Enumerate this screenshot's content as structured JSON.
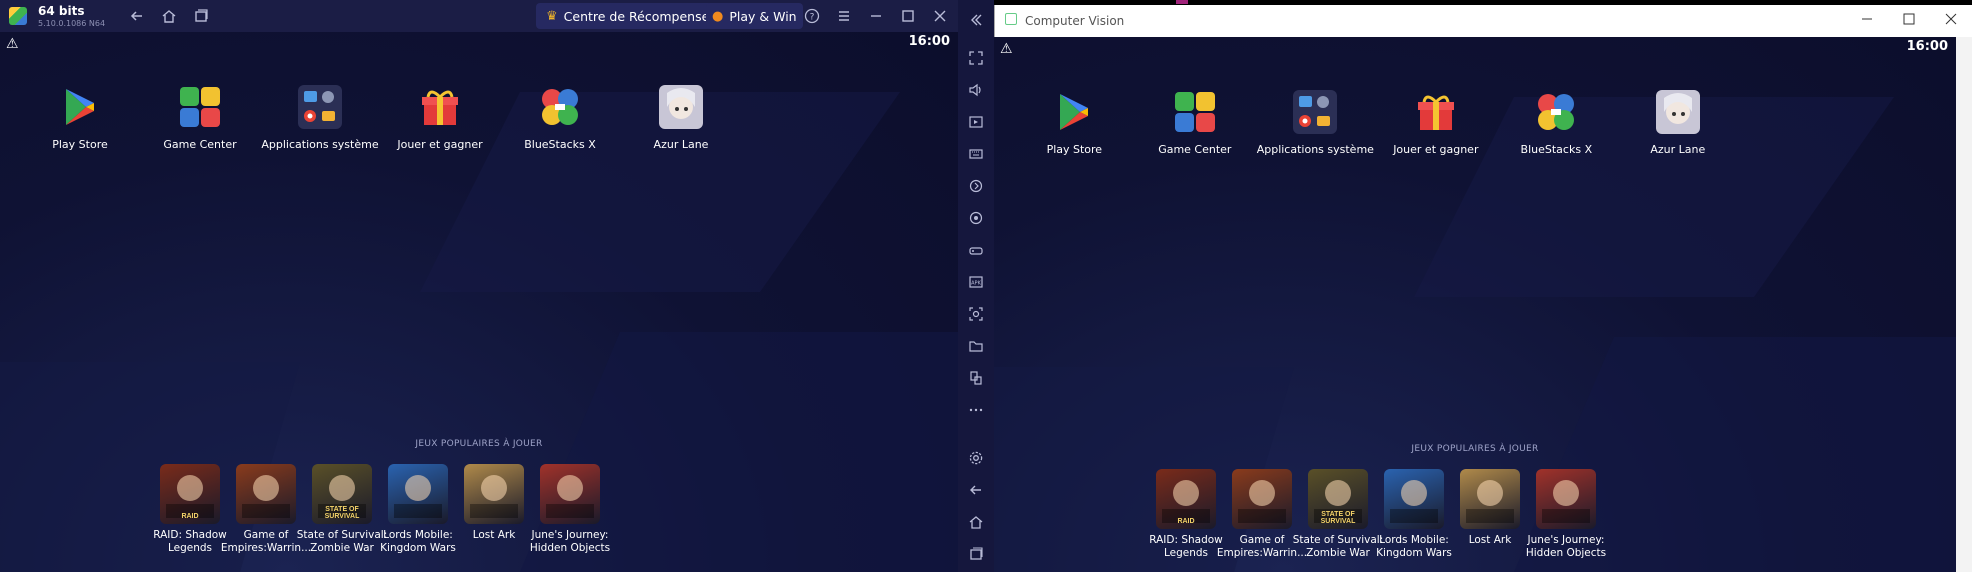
{
  "bluestacks": {
    "title": "64 bits",
    "version": "5.10.0.1086 N64",
    "reward_label": "Centre de  Récompense",
    "playwin_label": "Play & Win"
  },
  "android": {
    "clock": "16:00",
    "apps": [
      {
        "label": "Play Store",
        "icon": "play-store-icon"
      },
      {
        "label": "Game Center",
        "icon": "game-center-icon"
      },
      {
        "label": "Applications système",
        "icon": "system-apps-icon"
      },
      {
        "label": "Jouer et gagner",
        "icon": "gift-icon"
      },
      {
        "label": "BlueStacks X",
        "icon": "bluestacks-x-icon"
      },
      {
        "label": "Azur Lane",
        "icon": "azur-lane-icon"
      }
    ],
    "popular_title": "JEUX POPULAIRES À JOUER",
    "games": [
      {
        "line1": "RAID: Shadow",
        "line2": "Legends",
        "icon_text": "RAID",
        "color": "#7a2b1a"
      },
      {
        "line1": "Game of",
        "line2": "Empires:Warrin...",
        "icon_text": "",
        "color": "#8a3b1c"
      },
      {
        "line1": "State of Survival:",
        "line2": "Zombie War",
        "icon_text": "STATE OF SURVIVAL",
        "color": "#5a5028"
      },
      {
        "line1": "Lords Mobile:",
        "line2": "Kingdom Wars",
        "icon_text": "",
        "color": "#2a63b0"
      },
      {
        "line1": "Lost Ark",
        "line2": "",
        "icon_text": "",
        "color": "#b08a4a"
      },
      {
        "line1": "June's Journey:",
        "line2": "Hidden Objects",
        "icon_text": "",
        "color": "#a1322a"
      }
    ]
  },
  "window2": {
    "title": "Computer Vision"
  },
  "colors": {
    "bg": "#0e1030",
    "bar": "#1b1d45"
  }
}
